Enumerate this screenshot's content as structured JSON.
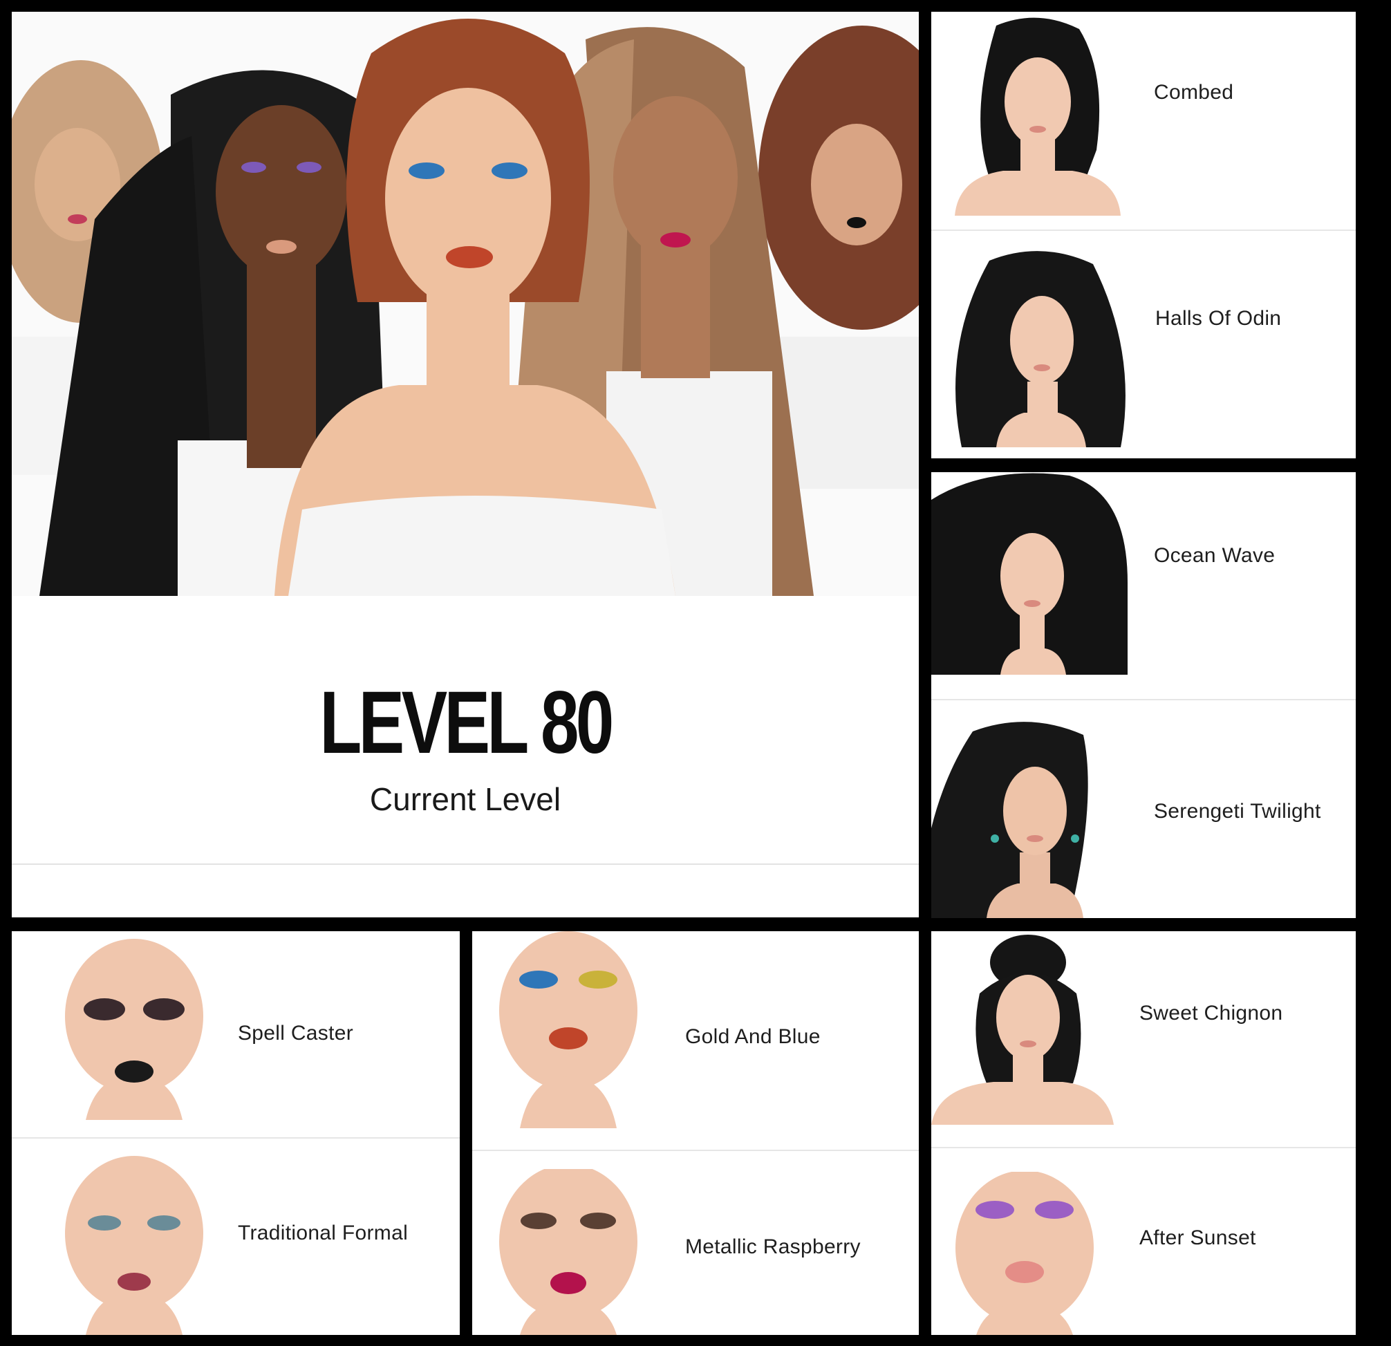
{
  "level": {
    "number": "LEVEL 80",
    "caption": "Current Level"
  },
  "hairstyles": [
    {
      "label": "Combed"
    },
    {
      "label": "Halls Of Odin"
    },
    {
      "label": "Ocean Wave"
    },
    {
      "label": "Serengeti Twilight"
    },
    {
      "label": "Sweet Chignon"
    }
  ],
  "makeup": [
    {
      "label": "Spell Caster"
    },
    {
      "label": "Traditional Formal"
    },
    {
      "label": "Gold And Blue"
    },
    {
      "label": "Metallic Raspberry"
    },
    {
      "label": "After Sunset"
    }
  ],
  "colors": {
    "border": "#000000",
    "panel": "#ffffff",
    "divider": "#e6e6e6",
    "hair": "#141414",
    "skin": "#f1c9b1"
  }
}
